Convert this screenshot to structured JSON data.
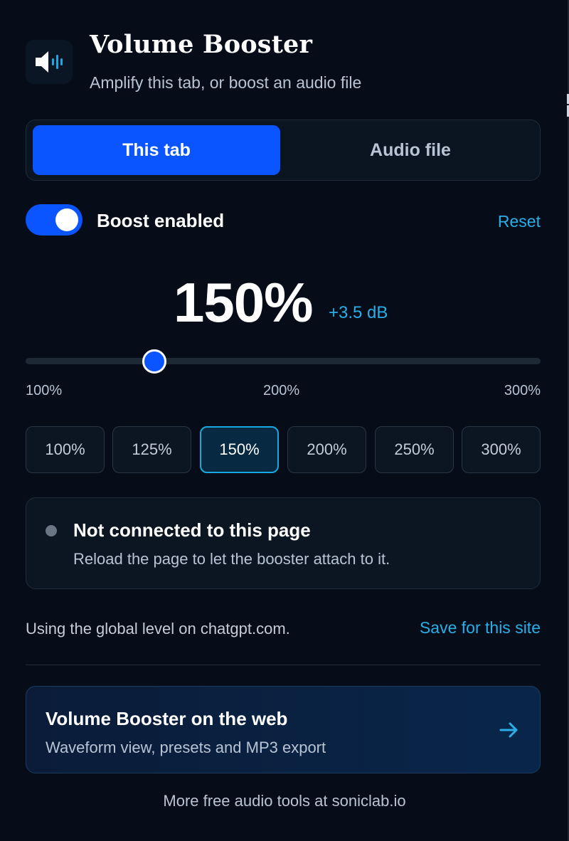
{
  "header": {
    "icon": "speaker-wave-icon",
    "title": "Volume Booster",
    "subtitle": "Amplify this tab, or boost an audio file"
  },
  "tabs": [
    {
      "label": "This tab",
      "active": true
    },
    {
      "label": "Audio file",
      "active": false
    }
  ],
  "boost": {
    "enabled": true,
    "label": "Boost enabled",
    "reset_label": "Reset"
  },
  "level": {
    "value_text": "150%",
    "db_text": "+3.5 dB",
    "value_percent": 150
  },
  "slider": {
    "min": 100,
    "max": 300,
    "value": 150,
    "ticks": [
      "100%",
      "200%",
      "300%"
    ]
  },
  "presets": [
    {
      "label": "100%",
      "active": false
    },
    {
      "label": "125%",
      "active": false
    },
    {
      "label": "150%",
      "active": true
    },
    {
      "label": "200%",
      "active": false
    },
    {
      "label": "250%",
      "active": false
    },
    {
      "label": "300%",
      "active": false
    }
  ],
  "status": {
    "title": "Not connected to this page",
    "description": "Reload the page to let the booster attach to it."
  },
  "site": {
    "text": "Using the global level on chatgpt.com.",
    "save_label": "Save for this site"
  },
  "promo": {
    "title": "Volume Booster on the web",
    "description": "Waveform view, presets and MP3 export",
    "icon": "arrow-right-icon"
  },
  "footer": {
    "text": "More free audio tools at soniclab.io"
  },
  "colors": {
    "background": "#060d18",
    "accent": "#0a55ff",
    "link": "#29aee8"
  }
}
